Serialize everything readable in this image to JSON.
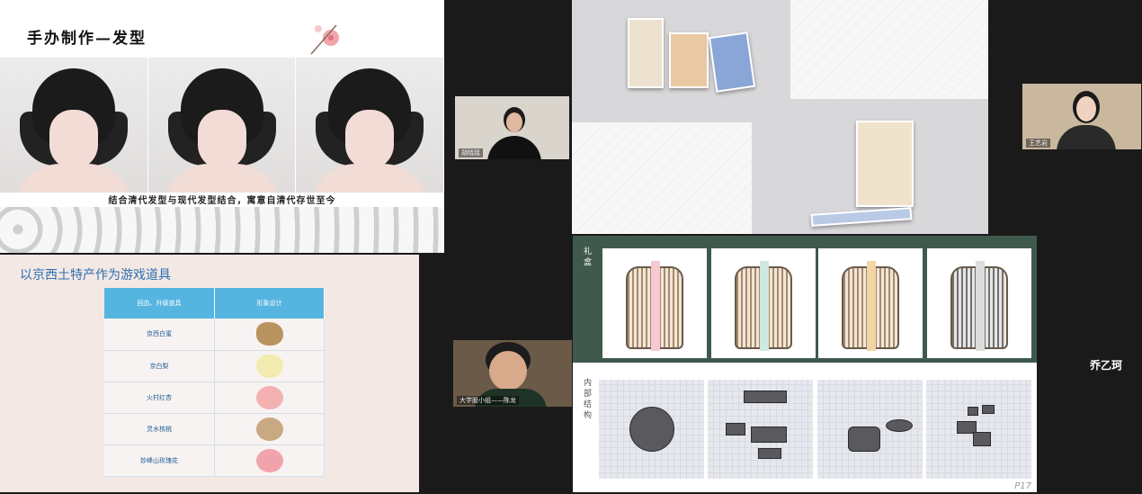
{
  "hair_slide": {
    "title": "手办制作—发型",
    "caption": "结合清代发型与现代发型结合，寓意自清代存世至今"
  },
  "props_slide": {
    "title": "以京西土特产作为游戏道具",
    "headers": [
      "回血、升级道具",
      "形象设计"
    ],
    "rows": [
      "京西白蜜",
      "京白梨",
      "火村红杏",
      "灵水核桃",
      "妙峰山玫瑰花"
    ]
  },
  "box_slide": {
    "label_top": [
      "礼",
      "盒"
    ],
    "label_bottom": [
      "内",
      "部",
      "结",
      "构"
    ],
    "page": "P17"
  },
  "participants": {
    "tile_a": "胡晓瑶",
    "tile_b": "王艺岩",
    "tile_c": "大学股小组——陈龙",
    "name_right": "乔乙珂"
  },
  "colors": {
    "table_header": "#56b5e0",
    "green_band": "#3f5a4d",
    "slide_title_blue": "#2d6fb0"
  }
}
